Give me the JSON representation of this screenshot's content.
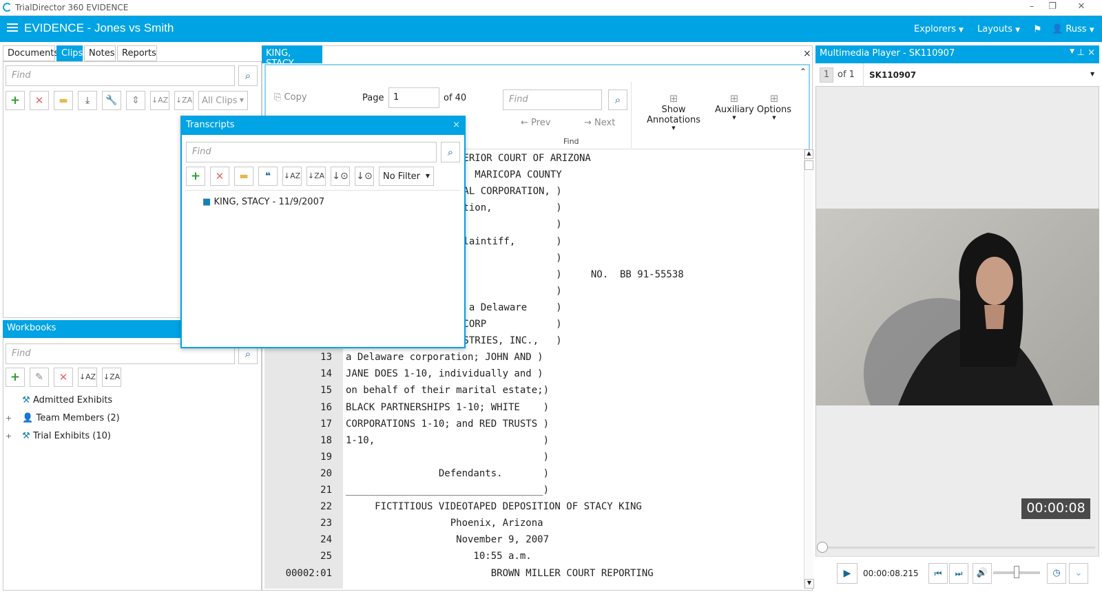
{
  "window": {
    "title": "TrialDirector 360 EVIDENCE",
    "controls": [
      "–",
      "❐",
      "✕"
    ]
  },
  "header": {
    "title": "EVIDENCE - Jones vs Smith",
    "explorers": "Explorers",
    "layouts": "Layouts",
    "user": "Russ"
  },
  "left": {
    "tabs": [
      "Documents",
      "Clips",
      "Notes",
      "Reports"
    ],
    "find_placeholder": "Find",
    "filter": "All Clips"
  },
  "workbooks": {
    "title": "Workbooks",
    "find_placeholder": "Find",
    "items": [
      {
        "label": "Admitted Exhibits",
        "expand": ""
      },
      {
        "label": "Team Members (2)",
        "expand": "+"
      },
      {
        "label": "Trial Exhibits (10)",
        "expand": "+"
      }
    ]
  },
  "transcripts": {
    "title": "Transcripts",
    "close": "×",
    "find_placeholder": "Find",
    "filter": "No Filter",
    "items": [
      "KING, STACY - 11/9/2007"
    ]
  },
  "viewer": {
    "tab": "KING, STACY",
    "close": "×",
    "copy": "Copy",
    "page_label": "Page",
    "page_value": "1",
    "page_of": "of 40",
    "next_page": "Next",
    "find_placeholder": "Find",
    "prev": "Prev",
    "next": "Next",
    "find_group": "Find",
    "show_annotations": "Show Annotations",
    "auxiliary": "Auxiliary",
    "options": "Options",
    "lines": [
      {
        "num": "",
        "text": "PERIOR COURT OF ARIZONA"
      },
      {
        "num": "",
        "text": "   MARICOPA COUNTY"
      },
      {
        "num": "",
        "text": "IAL CORPORATION, )"
      },
      {
        "num": "",
        "text": "ation,           )"
      },
      {
        "num": "",
        "text": "                 )"
      },
      {
        "num": "",
        "text": "Plaintiff,       )"
      },
      {
        "num": "",
        "text": "                 )"
      },
      {
        "num": "",
        "text": "                 )     NO.  BB 91-55538"
      },
      {
        "num": "",
        "text": "                 )"
      },
      {
        "num": "",
        "text": "  a Delaware     )"
      },
      {
        "num": "",
        "text": "-CORP            )"
      },
      {
        "num": "",
        "text": "USTRIES, INC.,   )"
      },
      {
        "num": "13",
        "text": "a Delaware corporation; JOHN AND )"
      },
      {
        "num": "14",
        "text": "JANE DOES 1-10, individually and )"
      },
      {
        "num": "15",
        "text": "on behalf of their marital estate;)"
      },
      {
        "num": "16",
        "text": "BLACK PARTNERSHIPS 1-10; WHITE    )"
      },
      {
        "num": "17",
        "text": "CORPORATIONS 1-10; and RED TRUSTS )"
      },
      {
        "num": "18",
        "text": "1-10,                             )"
      },
      {
        "num": "19",
        "text": "                                  )"
      },
      {
        "num": "20",
        "text": "                Defendants.       )"
      },
      {
        "num": "21",
        "text": "__________________________________)"
      },
      {
        "num": "22",
        "text": "     FICTITIOUS VIDEOTAPED DEPOSITION OF STACY KING"
      },
      {
        "num": "23",
        "text": "                  Phoenix, Arizona"
      },
      {
        "num": "24",
        "text": "                   November 9, 2007"
      },
      {
        "num": "25",
        "text": "                      10:55 a.m."
      },
      {
        "num": "00002:01",
        "text": "                         BROWN MILLER COURT REPORTING"
      }
    ]
  },
  "player": {
    "title": "Multimedia Player - SK110907",
    "page": "1",
    "of": "of 1",
    "clip": "SK110907",
    "timestamp": "00:00:08",
    "time": "00:00:08.215",
    "progress": 0.0,
    "volume": 0.5
  },
  "colors": {
    "accent": "#00a3e3",
    "panel_border": "#c9c9c9"
  }
}
